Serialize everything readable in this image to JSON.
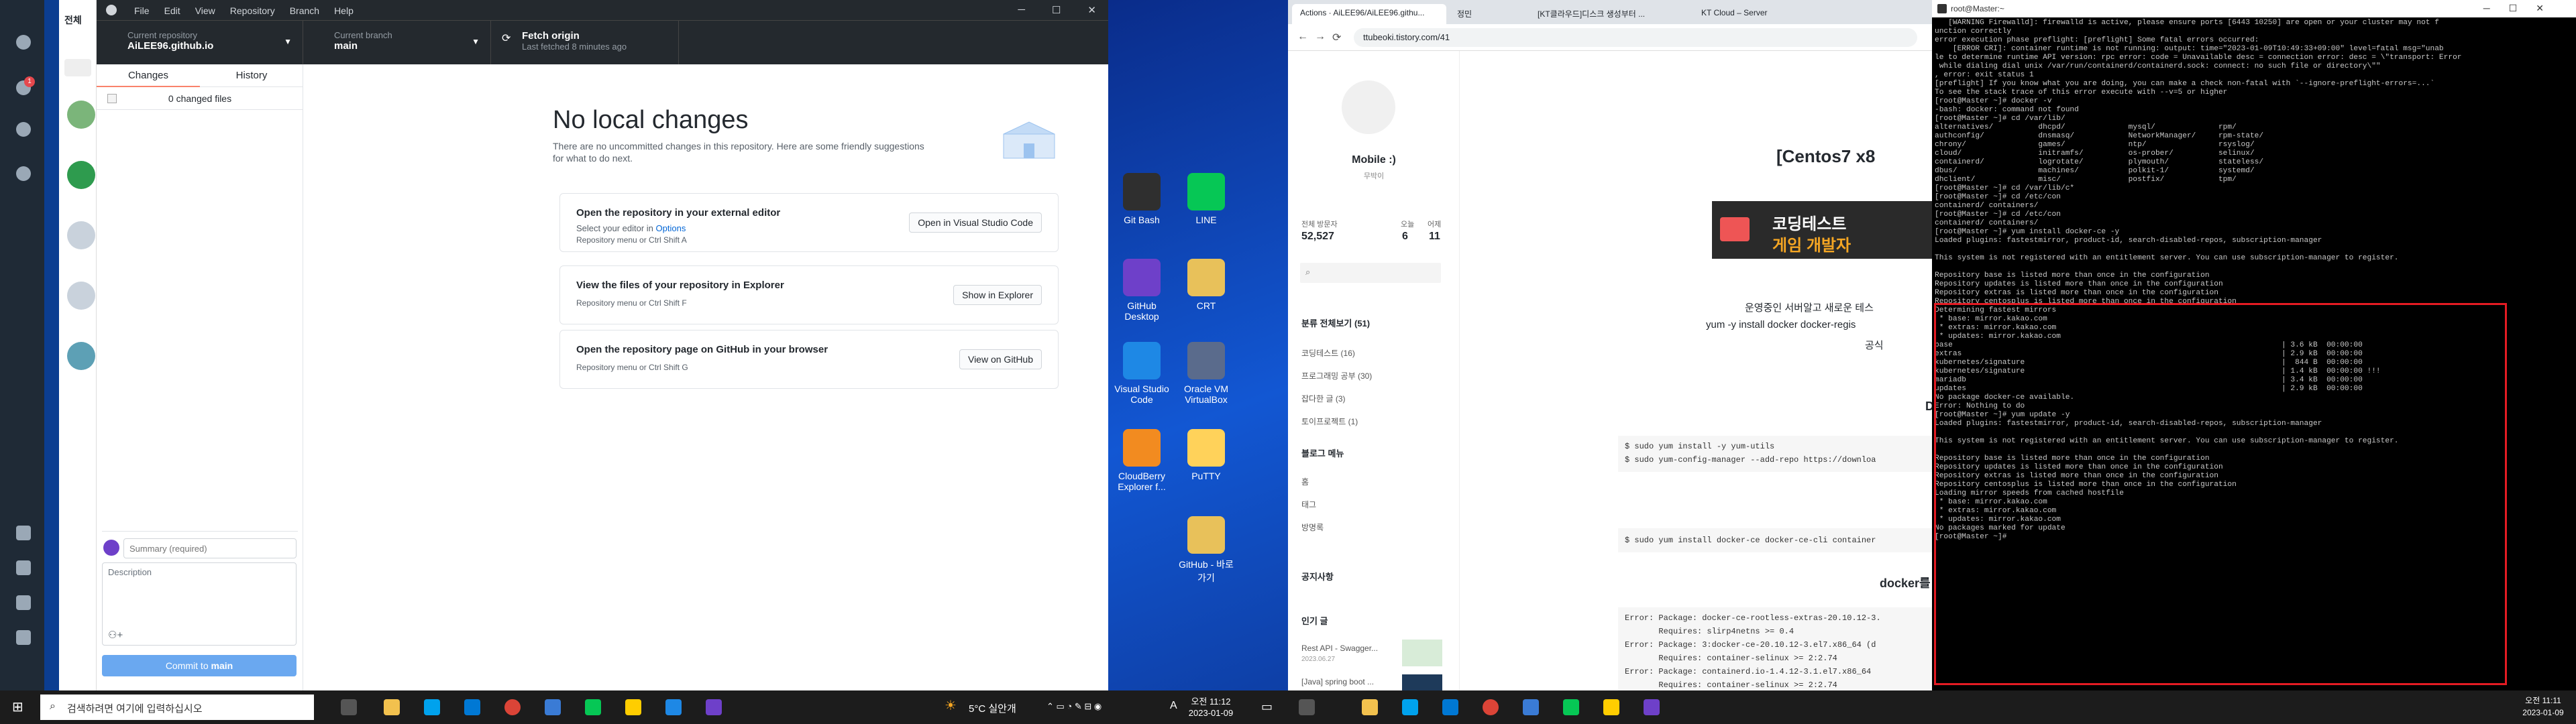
{
  "messenger": {
    "header": "전체",
    "badge": "1"
  },
  "github_desktop": {
    "menu": [
      "File",
      "Edit",
      "View",
      "Repository",
      "Branch",
      "Help"
    ],
    "current_repository_label": "Current repository",
    "current_repository": "AiLEE96.github.io",
    "current_branch_label": "Current branch",
    "current_branch": "main",
    "fetch_label": "Fetch origin",
    "fetch_sub": "Last fetched 8 minutes ago",
    "tab_changes": "Changes",
    "tab_history": "History",
    "changed_files": "0 changed files",
    "summary_placeholder": "Summary (required)",
    "description_placeholder": "Description",
    "commit_label": "Commit to ",
    "commit_branch": "main",
    "title": "No local changes",
    "subtitle_1": "There are no uncommitted changes in this repository. Here are some friendly suggestions",
    "subtitle_2": "for what to do next.",
    "cards": [
      {
        "title": "Open the repository in your external editor",
        "desc": "Select your editor in ",
        "link": "Options",
        "shortcut": "Repository menu or  Ctrl  Shift  A",
        "button": "Open in Visual Studio Code"
      },
      {
        "title": "View the files of your repository in Explorer",
        "desc": "",
        "link": "",
        "shortcut": "Repository menu or  Ctrl  Shift  F",
        "button": "Show in Explorer"
      },
      {
        "title": "Open the repository page on GitHub in your browser",
        "desc": "",
        "link": "",
        "shortcut": "Repository menu or  Ctrl  Shift  G",
        "button": "View on GitHub"
      }
    ]
  },
  "desktop_icons": [
    {
      "label": "Git Bash",
      "color": "#2f2f2f"
    },
    {
      "label": "LINE",
      "color": "#06c755"
    },
    {
      "label": "GitHub Desktop",
      "color": "#6e40c9"
    },
    {
      "label": "CRT",
      "color": "#e8c15a"
    },
    {
      "label": "Visual Studio Code",
      "color": "#1e88e5"
    },
    {
      "label": "Oracle VM VirtualBox",
      "color": "#5a6b8c"
    },
    {
      "label": "CloudBerry Explorer f...",
      "color": "#f28b20"
    },
    {
      "label": "PuTTY",
      "color": "#ffd25a"
    },
    {
      "label": "GitHub - 바로 가기",
      "color": "#e8c15a"
    }
  ],
  "browser": {
    "tabs": [
      "Actions · AiLEE96/AiLEE96.githu...",
      "정민",
      "[KT클라우드]디스크 생성부터 ...",
      "KT Cloud – Server"
    ],
    "url": "ttubeoki.tistory.com/41",
    "blog_name": "Mobile :)",
    "blog_sub": "무박이",
    "stats": {
      "total_label": "전체 방문자",
      "total": "52,527",
      "today_label": "오늘",
      "today": "6",
      "yesterday_label": "어제",
      "yesterday": "11"
    },
    "categories_title": "분류 전체보기 (51)",
    "categories": [
      "코딩테스트 (16)",
      "프로그래밍 공부 (30)",
      "잡다한 글 (3)",
      "토이프로젝트 (1)"
    ],
    "menu_title": "블로그 메뉴",
    "menu": [
      "홈",
      "태그",
      "방명록"
    ],
    "notice": "공지사항",
    "popular": "인기 글",
    "popular_items": [
      {
        "title": "Rest API - Swagger...",
        "date": "2023.06.27"
      },
      {
        "title": "[Java] spring boot ...",
        "date": ""
      }
    ],
    "post_title": "[Centos7 x8",
    "banner_1": "코딩테스트",
    "banner_2": "게임 개발자",
    "paragraph_1": "운영중인 서버알고 새로운 테스",
    "paragraph_2": "yum -y install docker docker-regis",
    "paragraph_3": "공식",
    "heading_d": "D",
    "code_1": "$ sudo yum install -y yum-utils\n$ sudo yum-config-manager --add-repo https://downloa",
    "code_2": "$ sudo yum install docker-ce docker-ce-cli container",
    "heading_docker": "docker를",
    "code_3": "Error: Package: docker-ce-rootless-extras-20.10.12-3.\n       Requires: slirp4netns >= 0.4\nError: Package: 3:docker-ce-20.10.12-3.el7.x86_64 (d\n       Requires: container-selinux >= 2:2.74\nError: Package: containerd.io-1.4.12-3.1.el7.x86_64\n       Requires: container-selinux >= 2:2.74"
  },
  "terminal": {
    "title": "root@Master:~",
    "text": "   [WARNING Firewalld]: firewalld is active, please ensure ports [6443 10250] are open or your cluster may not f\nunction correctly\nerror execution phase preflight: [preflight] Some fatal errors occurred:\n    [ERROR CRI]: container runtime is not running: output: time=\"2023-01-09T10:49:33+09:00\" level=fatal msg=\"unab\nle to determine runtime API version: rpc error: code = Unavailable desc = connection error: desc = \\\"transport: Error\n while dialing dial unix /var/run/containerd/containerd.sock: connect: no such file or directory\\\"\"\n, error: exit status 1\n[preflight] If you know what you are doing, you can make a check non-fatal with `--ignore-preflight-errors=...`\nTo see the stack trace of this error execute with --v=5 or higher\n[root@Master ~]# docker -v\n-bash: docker: command not found\n[root@Master ~]# cd /var/lib/\nalternatives/          dhcpd/              mysql/              rpm/\nauthconfig/            dnsmasq/            NetworkManager/     rpm-state/\nchrony/                games/              ntp/                rsyslog/\ncloud/                 initramfs/          os-prober/          selinux/\ncontainerd/            logrotate/          plymouth/           stateless/\ndbus/                  machines/           polkit-1/           systemd/\ndhclient/              misc/               postfix/            tpm/\n[root@Master ~]# cd /var/lib/c*\n[root@Master ~]# cd /etc/con\ncontainerd/ containers/\n[root@Master ~]# cd /etc/con\ncontainerd/ containers/\n[root@Master ~]# yum install docker-ce -y\nLoaded plugins: fastestmirror, product-id, search-disabled-repos, subscription-manager\n\nThis system is not registered with an entitlement server. You can use subscription-manager to register.\n\nRepository base is listed more than once in the configuration\nRepository updates is listed more than once in the configuration\nRepository extras is listed more than once in the configuration\nRepository centosplus is listed more than once in the configuration\nDetermining fastest mirrors\n * base: mirror.kakao.com\n * extras: mirror.kakao.com\n * updates: mirror.kakao.com\nbase                                                                         | 3.6 kB  00:00:00\nextras                                                                       | 2.9 kB  00:00:00\nkubernetes/signature                                                         |  844 B  00:00:00\nkubernetes/signature                                                         | 1.4 kB  00:00:00 !!!\nmariadb                                                                      | 3.4 kB  00:00:00\nupdates                                                                      | 2.9 kB  00:00:00\nNo package docker-ce available.\nError: Nothing to do\n[root@Master ~]# yum update -y\nLoaded plugins: fastestmirror, product-id, search-disabled-repos, subscription-manager\n\nThis system is not registered with an entitlement server. You can use subscription-manager to register.\n\nRepository base is listed more than once in the configuration\nRepository updates is listed more than once in the configuration\nRepository extras is listed more than once in the configuration\nRepository centosplus is listed more than once in the configuration\nLoading mirror speeds from cached hostfile\n * base: mirror.kakao.com\n * extras: mirror.kakao.com\n * updates: mirror.kakao.com\nNo packages marked for update\n[root@Master ~]# "
  },
  "taskbar_left": {
    "search_placeholder": "검색하려면 여기에 입력하십시오",
    "weather": "5°C 실안개",
    "time": "오전 11:12",
    "date": "2023-01-09",
    "ime": "A"
  },
  "taskbar_right": {
    "time": "오전 11:11",
    "date": "2023-01-09"
  }
}
